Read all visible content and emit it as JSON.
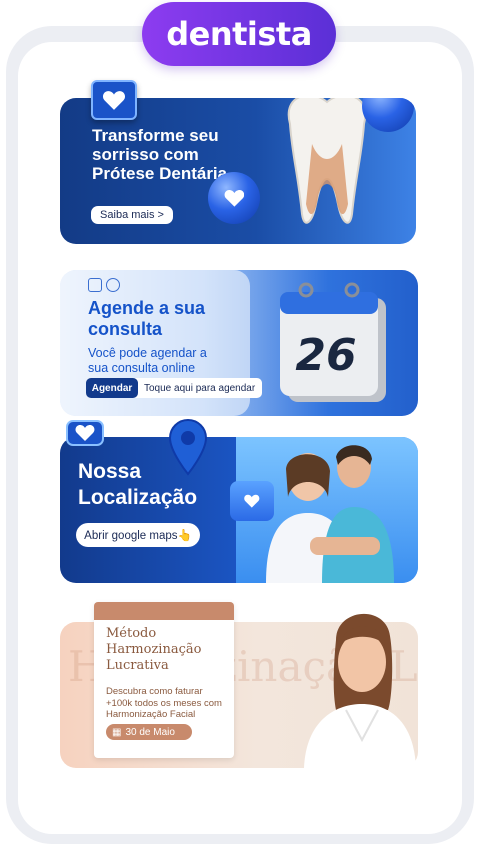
{
  "header": {
    "label": "dentista"
  },
  "cards": [
    {
      "title": "Transforme seu sorrisso com Prótese Dentária",
      "button": "Saiba mais >"
    },
    {
      "title": "Agende a sua consulta",
      "subtitle": "Você pode agendar a sua consulta online",
      "button": "Agendar",
      "hint": "Toque aqui para agendar",
      "calendar_day": "26"
    },
    {
      "title": "Nossa Localização",
      "button": "Abrir google maps👆"
    },
    {
      "title": "Método Harmozinação Lucrativa",
      "subtitle": "Descubra como faturar +100k todos os meses com Harmonização Facial",
      "date": "30 de Maio",
      "bg_word": "Harmozinação Lucrativa"
    }
  ],
  "colors": {
    "brand_purple": "#8d3cf0",
    "brand_blue": "#1a4da6",
    "accent_tan": "#c88a6c"
  }
}
